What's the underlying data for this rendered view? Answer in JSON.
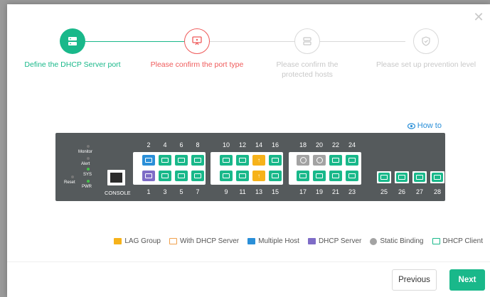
{
  "steps": [
    {
      "label": "Define the DHCP Server port",
      "state": "active"
    },
    {
      "label": "Please confirm the port type",
      "state": "current"
    },
    {
      "label": "Please confirm the protected hosts",
      "state": "todo"
    },
    {
      "label": "Please set up prevention level",
      "state": "todo"
    }
  ],
  "how_to": "How to",
  "switch": {
    "leds": {
      "monitor": "Monitor",
      "alert": "Alert",
      "sys": "SYS",
      "pwr": "PWR",
      "reset": "Reset"
    },
    "console_label": "CONSOLE",
    "top_ports": [
      "2",
      "4",
      "6",
      "8",
      "10",
      "12",
      "14",
      "16",
      "18",
      "20",
      "22",
      "24"
    ],
    "bottom_ports": [
      "1",
      "3",
      "5",
      "7",
      "9",
      "11",
      "13",
      "15",
      "17",
      "19",
      "21",
      "23"
    ],
    "sfp_ports": [
      "25",
      "26",
      "27",
      "28"
    ]
  },
  "legend": [
    {
      "label": "LAG Group",
      "color": "#f6b21a"
    },
    {
      "label": "With DHCP Server",
      "color": "#f0a04b"
    },
    {
      "label": "Multiple Host",
      "color": "#2a8fd8"
    },
    {
      "label": "DHCP Server",
      "color": "#7e6cc7"
    },
    {
      "label": "Static Binding",
      "color": "#a3a3a3"
    },
    {
      "label": "DHCP Client",
      "color": "#19b88a"
    }
  ],
  "buttons": {
    "previous": "Previous",
    "next": "Next"
  }
}
